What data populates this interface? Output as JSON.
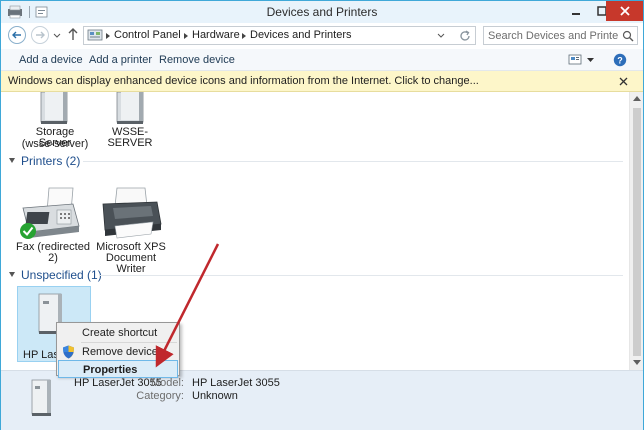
{
  "window": {
    "title": "Devices and Printers"
  },
  "address": {
    "crumbs": [
      "Control Panel",
      "Hardware",
      "Devices and Printers"
    ],
    "search_placeholder": "Search Devices and Printers"
  },
  "toolbar": {
    "add_device": "Add a device",
    "add_printer": "Add a printer",
    "remove_device": "Remove device"
  },
  "infobar": {
    "text": "Windows can display enhanced device icons and information from the Internet. Click to change..."
  },
  "devices_top": [
    {
      "label_lines": [
        "Storage Server",
        "(wsse-server)"
      ]
    },
    {
      "label_lines": [
        "WSSE-SERVER"
      ]
    }
  ],
  "printers": {
    "header": "Printers (2)",
    "items": [
      {
        "label_lines": [
          "Fax (redirected 2)"
        ],
        "icon": "fax-icon"
      },
      {
        "label_lines": [
          "Microsoft XPS",
          "Document Writer"
        ],
        "icon": "printer-icon"
      }
    ]
  },
  "unspecified": {
    "header": "Unspecified (1)",
    "items": [
      {
        "label_lines": [
          "HP Laser"
        ],
        "icon": "tower-device-icon"
      }
    ]
  },
  "context_menu": {
    "items": [
      "Create shortcut",
      "Remove device",
      "Properties"
    ]
  },
  "details": {
    "name": "HP LaserJet 3055",
    "model_key": "Model:",
    "model_value": "HP LaserJet 3055",
    "category_key": "Category:",
    "category_value": "Unknown"
  },
  "colors": {
    "accent": "#3fa8d8",
    "close_button": "#c7382b",
    "infobar": "#fdf6c9",
    "selection": "#cce8f7",
    "annotation_arrow": "#c0282d"
  }
}
